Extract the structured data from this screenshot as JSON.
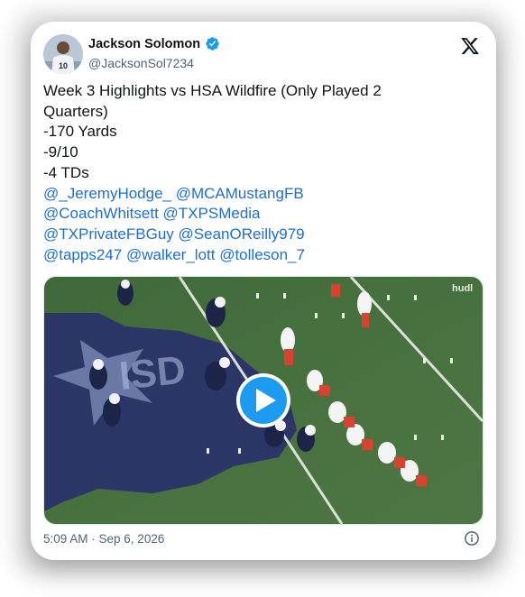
{
  "author": {
    "display_name": "Jackson Solomon",
    "handle": "@JacksonSol7234",
    "avatar_icon": "avatar-photo",
    "verified_icon": "verified-badge-icon"
  },
  "logo_icon": "x-logo-icon",
  "tweet": {
    "lines": [
      "Week 3 Highlights vs HSA Wildfire (Only Played 2",
      "Quarters)",
      "-170 Yards",
      "-9/10",
      "-4 TDs"
    ],
    "mention_lines": [
      [
        "@_JeremyHodge_",
        "@MCAMustangFB"
      ],
      [
        "@CoachWhitsett",
        "@TXPSMedia"
      ],
      [
        "@TXPrivateFBGuy",
        "@SeanOReilly979"
      ],
      [
        "@tapps247",
        "@walker_lott",
        "@tolleson_7"
      ]
    ]
  },
  "media": {
    "field_text": "ISD",
    "watermark": "hudl",
    "play_icon": "play-button-icon"
  },
  "timestamp": "5:09 AM · Sep 6, 2026",
  "info_icon": "info-icon",
  "colors": {
    "link": "#1d6fd0",
    "verified": "#1d9bf0",
    "play_button": "#1d9bf0",
    "field_green": "#3f6b3a",
    "logo_navy": "#2b3566"
  }
}
